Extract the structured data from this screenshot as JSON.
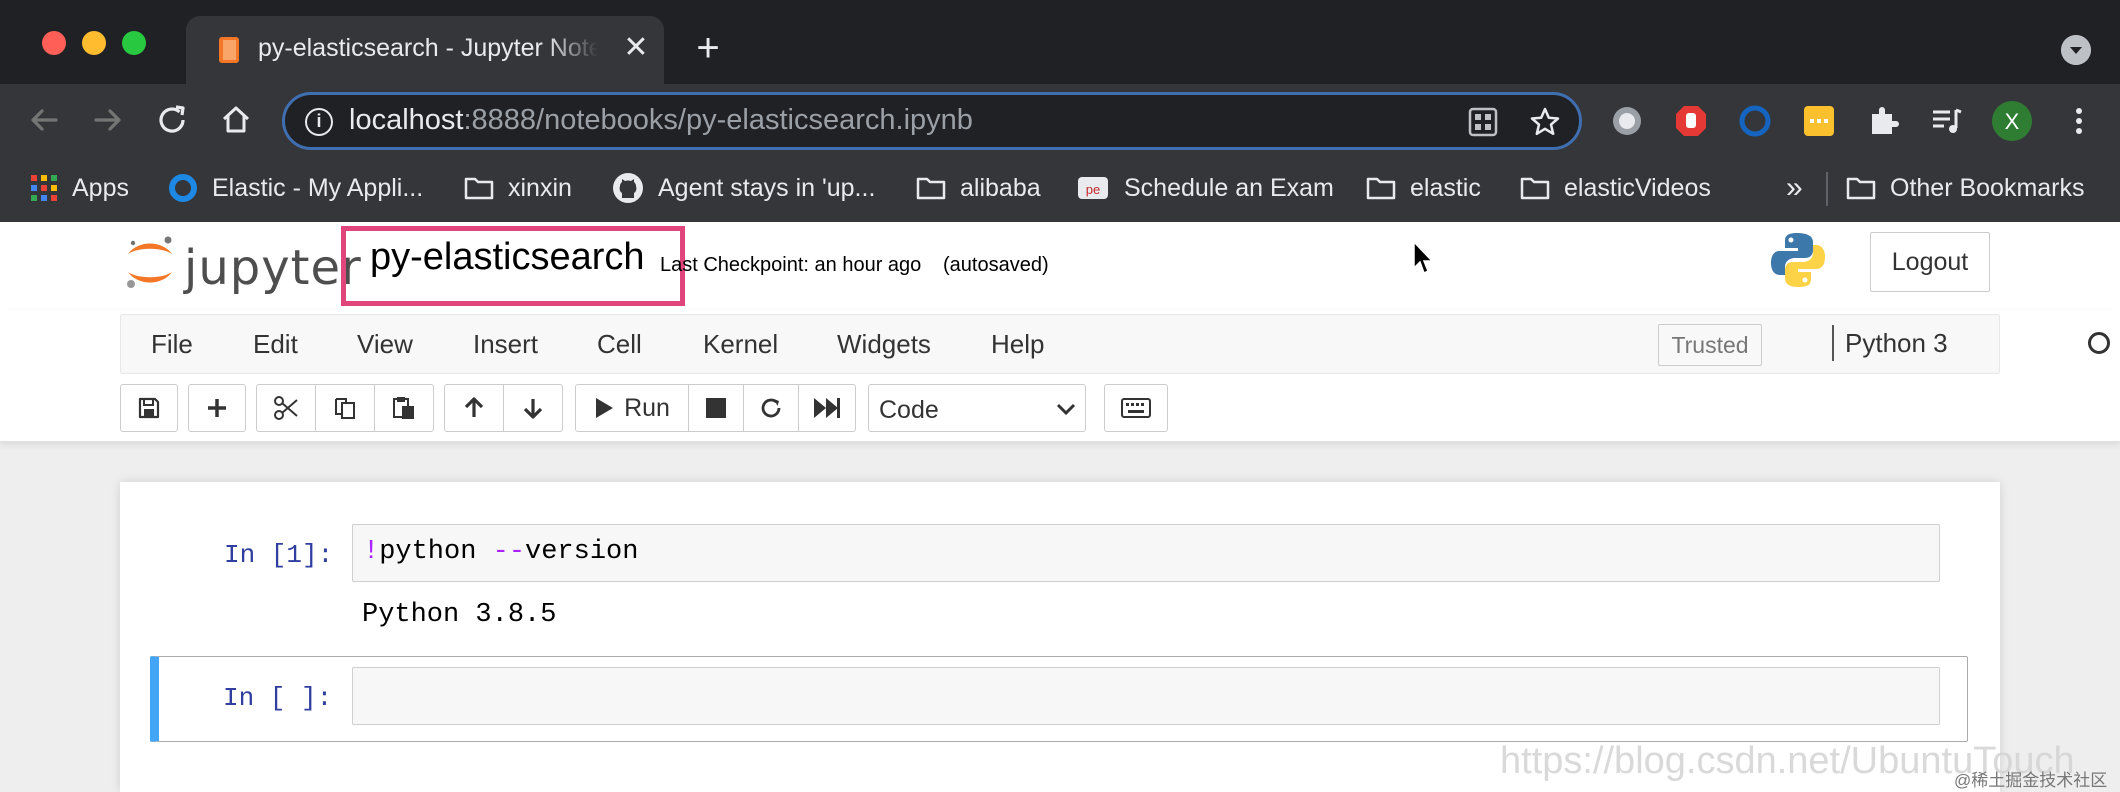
{
  "browser": {
    "tab_title": "py-elasticsearch - Jupyter Notebook",
    "tab_close": "✕",
    "new_tab": "+",
    "url_host": "localhost",
    "url_rest": ":8888/notebooks/py-elasticsearch.ipynb",
    "bookmarks": [
      {
        "label": "Apps",
        "icon": "apps-grid-icon"
      },
      {
        "label": "Elastic - My Appli...",
        "icon": "elastic-circle-icon"
      },
      {
        "label": "xinxin",
        "icon": "folder-icon"
      },
      {
        "label": "Agent stays in 'up...",
        "icon": "github-icon"
      },
      {
        "label": "alibaba",
        "icon": "folder-icon"
      },
      {
        "label": "Schedule an Exam",
        "icon": "exam-icon"
      },
      {
        "label": "elastic",
        "icon": "folder-icon"
      },
      {
        "label": "elasticVideos",
        "icon": "folder-icon"
      }
    ],
    "bookmarks_overflow": "»",
    "other_bookmarks": "Other Bookmarks",
    "profile_initial": "X"
  },
  "jupyter": {
    "logo_text": "jupyter",
    "notebook_name": "py-elasticsearch",
    "checkpoint": "Last Checkpoint: an hour ago",
    "autosaved": "(autosaved)",
    "logout": "Logout",
    "menu": [
      "File",
      "Edit",
      "View",
      "Insert",
      "Cell",
      "Kernel",
      "Widgets",
      "Help"
    ],
    "trusted": "Trusted",
    "kernel": "Python 3",
    "run_label": "Run",
    "cell_type": "Code"
  },
  "cells": [
    {
      "prompt": "In [1]:",
      "bang": "!",
      "code_cmd": "python ",
      "code_flag": "--",
      "code_arg": "version",
      "output": "Python 3.8.5"
    },
    {
      "prompt": "In [ ]:",
      "code": ""
    }
  ],
  "watermark": "https://blog.csdn.net/UbuntuTouch",
  "watermark_small": "@稀土掘金技术社区",
  "colors": {
    "chrome_bg": "#202124",
    "toolbar_bg": "#35363a",
    "omnibox_border": "#3f6fb1",
    "highlight_box": "#e0457b",
    "selected_cell": "#42a5f5",
    "prompt": "#303f9f"
  }
}
